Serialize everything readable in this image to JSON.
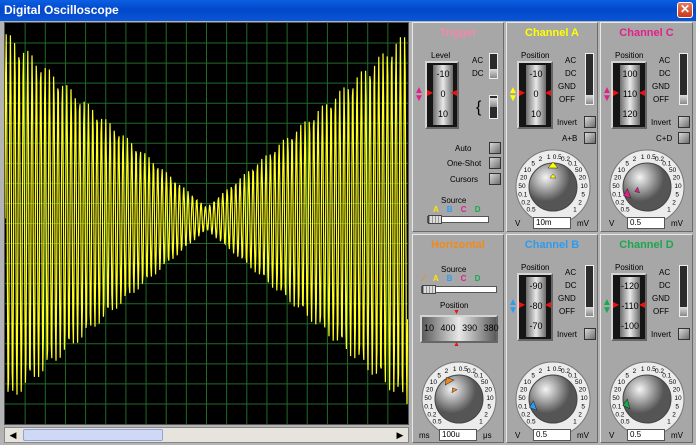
{
  "window": {
    "title": "Digital Oscilloscope",
    "close_label": "✕"
  },
  "colors": {
    "channel_a": "#ffff00",
    "channel_b": "#2b9cf0",
    "channel_c": "#e0218a",
    "channel_d": "#1aa84c",
    "trigger": "#f08aa8",
    "horizontal": "#f08a1c",
    "trace": "#ffff22",
    "grid": "#1f6b27"
  },
  "trigger": {
    "title": "Trigger",
    "level_label": "Level",
    "scale": [
      "-10",
      "0",
      "10"
    ],
    "coupling": [
      "AC",
      "DC"
    ],
    "modes": [
      "Auto",
      "One-Shot",
      "Cursors"
    ],
    "source_label": "Source",
    "sources": [
      "A",
      "B",
      "C",
      "D"
    ]
  },
  "channel_a": {
    "title": "Channel A",
    "position_label": "Position",
    "scale": [
      "-10",
      "0",
      "10"
    ],
    "coupling": [
      "AC",
      "DC",
      "GND",
      "OFF"
    ],
    "invert_label": "Invert",
    "combine_label": "A+B",
    "value": "10m",
    "unit_left": "V",
    "unit_right": "mV"
  },
  "channel_b": {
    "title": "Channel B",
    "position_label": "Position",
    "scale": [
      "-90",
      "-80",
      "-70"
    ],
    "coupling": [
      "AC",
      "DC",
      "GND",
      "OFF"
    ],
    "invert_label": "Invert",
    "value": "0.5",
    "unit_left": "V",
    "unit_right": "mV"
  },
  "channel_c": {
    "title": "Channel C",
    "position_label": "Position",
    "scale": [
      "100",
      "110",
      "120"
    ],
    "coupling": [
      "AC",
      "DC",
      "GND",
      "OFF"
    ],
    "invert_label": "Invert",
    "combine_label": "C+D",
    "value": "0.5",
    "unit_left": "V",
    "unit_right": "mV"
  },
  "channel_d": {
    "title": "Channel D",
    "position_label": "Position",
    "scale": [
      "-120",
      "-110",
      "-100"
    ],
    "coupling": [
      "AC",
      "DC",
      "GND",
      "OFF"
    ],
    "invert_label": "Invert",
    "value": "0.5",
    "unit_left": "V",
    "unit_right": "mV"
  },
  "horizontal": {
    "title": "Horizontal",
    "source_label": "Source",
    "sources": [
      "A",
      "B",
      "C",
      "D"
    ],
    "position_label": "Position",
    "position_scale": [
      "10",
      "400",
      "390",
      "380"
    ],
    "value": "100u",
    "unit_left": "ms",
    "unit_right": "μs"
  },
  "volt_dial": [
    "0.5",
    "0.2",
    "0.1",
    "50",
    "20",
    "10",
    "5",
    "2",
    "1",
    "0.5",
    "0.2",
    "0.1",
    "50",
    "20",
    "10",
    "5",
    "2",
    "1"
  ],
  "time_dial": [
    "0.5",
    "0.2",
    "0.1",
    "50",
    "20",
    "10",
    "5",
    "2",
    "1",
    "0.5",
    "0.2",
    "0.1",
    "50",
    "20",
    "10",
    "5",
    "2",
    "1",
    "200",
    "100",
    "50",
    "20",
    "10",
    "5",
    "2"
  ],
  "scrollbar": {
    "left_arrow": "◀",
    "right_arrow": "▶"
  }
}
